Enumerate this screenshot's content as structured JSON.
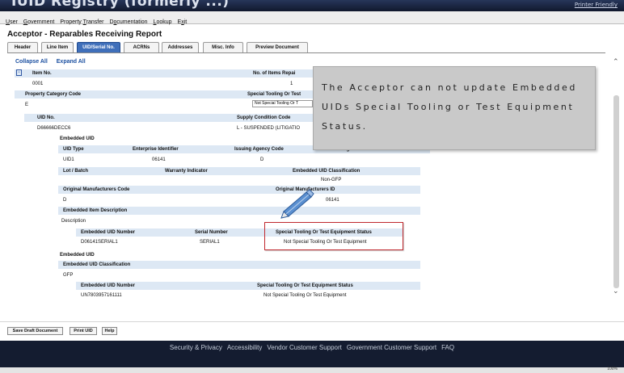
{
  "app": {
    "title": "IUID Registry (formerly ...)",
    "printer_friendly": "Printer Friendly"
  },
  "menu": [
    {
      "pre": "",
      "ul": "U",
      "post": "ser"
    },
    {
      "pre": "",
      "ul": "G",
      "post": "overnment"
    },
    {
      "pre": "Property ",
      "ul": "T",
      "post": "ransfer"
    },
    {
      "pre": "D",
      "ul": "o",
      "post": "cumentation"
    },
    {
      "pre": "",
      "ul": "L",
      "post": "ookup"
    },
    {
      "pre": "E",
      "ul": "x",
      "post": "it"
    }
  ],
  "page_title": "Acceptor - Reparables Receiving Report",
  "tabs": [
    "Header",
    "Line Item",
    "UID/Serial No.",
    "ACRNs",
    "Addresses",
    "Misc. Info",
    "Preview Document"
  ],
  "links": {
    "collapse_all": "Collapse All",
    "expand_all": "Expand All"
  },
  "collapse_toggle": "-",
  "table": {
    "item_no_label": "Item No.",
    "items_label": "No. of Items Repai",
    "item_no": "0001",
    "items": "1",
    "prop_cat_label": "Property Category Code",
    "special_test_label": "Special Tooling Or Test",
    "prop_cat": "E",
    "special_test_select": "Not Special Tooling Or T",
    "uid_no_label": "UID No.",
    "supply_cond_label": "Supply Condition Code",
    "uid_no": "D66666DECC6",
    "supply_cond": "L - SUSPENDED (LITIGATIO",
    "embedded_uid_1": "Embedded UID",
    "uid_type_label": "UID Type",
    "ent_id_label": "Enterprise Identifier",
    "agency_label": "Issuing Agency Code",
    "orig_part_label": "Original Part Number",
    "uid_type": "UID1",
    "ent_id": "06141",
    "agency": "D",
    "lot_batch_label": "Lot / Batch",
    "warranty_label": "Warranty Indicator",
    "emb_class_label": "Embedded UID Classification",
    "emb_class": "Non-GFP",
    "orig_mfr_code_label": "Original Manufacturers Code",
    "orig_mfr_id_label": "Original Manufacturers ID",
    "orig_mfr_code": "D",
    "orig_mfr_id": "06141",
    "emb_desc_label": "Embedded Item Description",
    "emb_desc": "Description",
    "emb_uid_num_label": "Embedded UID Number",
    "serial_label": "Serial Number",
    "special_status_label": "Special Tooling Or Test Equipment Status",
    "emb_uid_num": "D06141SERIAL1",
    "serial": "SERIAL1",
    "special_status": "Not Special Tooling Or Test Equipment",
    "embedded_uid_2": "Embedded UID",
    "emb_class_label_2": "Embedded UID Classification",
    "emb_class_2": "GFP",
    "emb_uid_num_label_2": "Embedded UID Number",
    "special_status_label_2": "Special Tooling Or Test Equipment Status",
    "emb_uid_num_2": "UN7803957161111",
    "special_status_2": "Not Special Tooling Or Test Equipment"
  },
  "callout": "The Acceptor can not update Embedded UIDs Special Tooling or Test Equipment Status.",
  "buttons": [
    "Save Draft Document",
    "Print UID",
    "Help"
  ],
  "footer": [
    "Security & Privacy",
    "Accessibility",
    "Vendor Customer Support",
    "Government Customer Support",
    "FAQ"
  ],
  "zoom": "100%",
  "colors": {
    "tab_active": "#3f6fba",
    "header_row": "#dde8f4",
    "highlight_box": "#c0282e",
    "footer_bg": "#141c30",
    "link": "#1a4fa0"
  }
}
